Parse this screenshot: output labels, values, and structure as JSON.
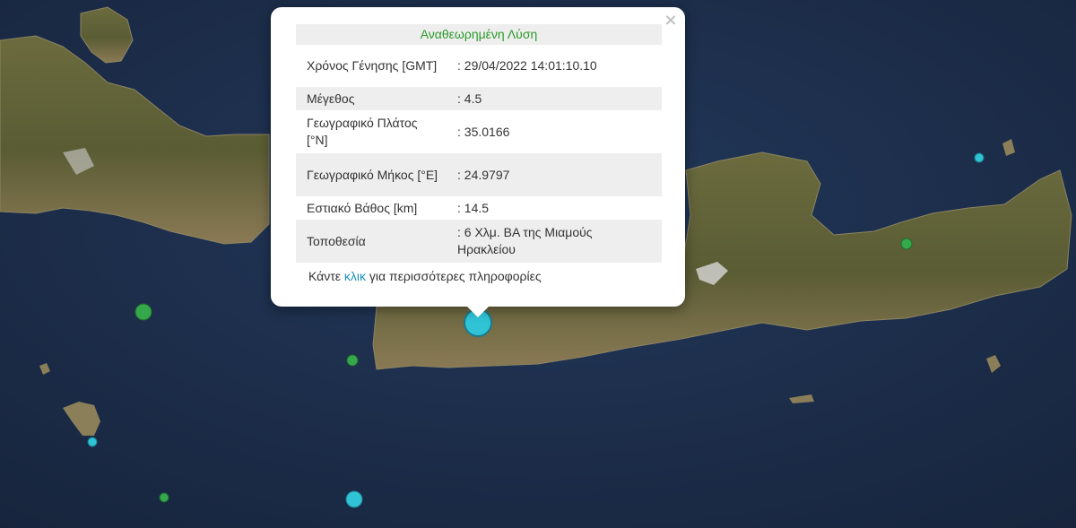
{
  "map": {
    "colors": {
      "sea": "#1b2b47",
      "land": "#5f6236",
      "marker_blue": "#30c3d6",
      "marker_green": "#35a84c"
    },
    "markers": [
      {
        "name": "selected-quake-marker",
        "color": "blue"
      },
      {
        "name": "quake-marker",
        "color": "green"
      },
      {
        "name": "quake-marker",
        "color": "green"
      },
      {
        "name": "quake-marker",
        "color": "green"
      },
      {
        "name": "quake-marker",
        "color": "green"
      },
      {
        "name": "quake-marker",
        "color": "blue"
      },
      {
        "name": "quake-marker",
        "color": "blue"
      },
      {
        "name": "quake-marker",
        "color": "blue"
      }
    ]
  },
  "popup": {
    "title": "Αναθεωρημένη Λύση",
    "close_icon": "×",
    "rows": [
      {
        "label": "Χρόνος Γένησης [GMT]",
        "value": ": 29/04/2022 14:01:10.10"
      },
      {
        "label": "Μέγεθος",
        "value": ": 4.5"
      },
      {
        "label": "Γεωγραφικό Πλάτος [°N]",
        "value": ": 35.0166"
      },
      {
        "label": "Γεωγραφικό Μήκος [°E]",
        "value": ": 24.9797"
      },
      {
        "label": "Εστιακό Βάθος [km]",
        "value": ": 14.5"
      },
      {
        "label": "Τοποθεσία",
        "value": ": 6 Χλμ. ΒΑ της Μιαμούς Ηρακλείου"
      }
    ],
    "more": {
      "prefix": "Κάντε ",
      "link": "κλικ",
      "suffix": " για περισσότερες πληροφορίες"
    }
  }
}
